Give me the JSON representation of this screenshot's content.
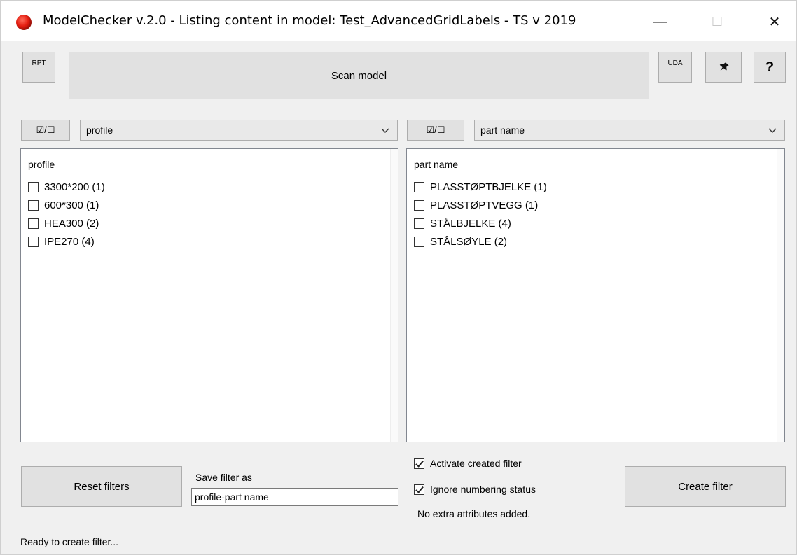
{
  "window": {
    "title": "ModelChecker v.2.0 - Listing content in model: Test_AdvancedGridLabels - TS v 2019",
    "controls": {
      "minimize": "—",
      "maximize": "☐",
      "close": "✕"
    }
  },
  "toolbar": {
    "rpt_label": "RPT",
    "scan_label": "Scan model",
    "uda_label": "UDA",
    "pin_icon": "pin-icon",
    "help_label": "?"
  },
  "left_panel": {
    "toggle_label": "☑/☐",
    "selected": "profile",
    "list_header": "profile",
    "items": [
      {
        "label": "3300*200 (1)",
        "checked": false
      },
      {
        "label": "600*300 (1)",
        "checked": false
      },
      {
        "label": "HEA300 (2)",
        "checked": false
      },
      {
        "label": "IPE270 (4)",
        "checked": false
      }
    ]
  },
  "right_panel": {
    "toggle_label": "☑/☐",
    "selected": "part name",
    "list_header": "part name",
    "items": [
      {
        "label": "PLASSTØPTBJELKE (1)",
        "checked": false
      },
      {
        "label": "PLASSTØPTVEGG (1)",
        "checked": false
      },
      {
        "label": "STÅLBJELKE (4)",
        "checked": false
      },
      {
        "label": "STÅLSØYLE (2)",
        "checked": false
      }
    ]
  },
  "bottom": {
    "reset_label": "Reset filters",
    "save_filter_label": "Save filter as",
    "save_filter_value": "profile-part name",
    "activate_label": "Activate created filter",
    "activate_checked": true,
    "ignore_label": "Ignore numbering status",
    "ignore_checked": true,
    "extra_attributes_text": "No extra attributes added.",
    "create_label": "Create filter"
  },
  "status": {
    "text": "Ready to create filter..."
  }
}
